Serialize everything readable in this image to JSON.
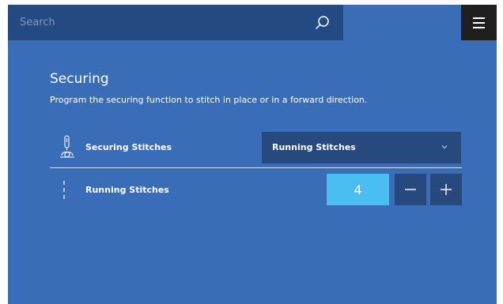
{
  "search": {
    "placeholder": "Search",
    "value": ""
  },
  "colors": {
    "background": "#3a6db8",
    "search_bar": "#244a84",
    "menu_button": "#1f1f1f",
    "field": "#26497e",
    "value_highlight": "#4bbef1"
  },
  "icons": {
    "search": "search-icon",
    "menu": "hamburger-menu-icon",
    "securing_stitches": "needle-knot-icon",
    "running_stitches": "dashed-line-icon",
    "dropdown": "chevron-down-icon",
    "decrease": "minus-icon",
    "increase": "plus-icon"
  },
  "section": {
    "title": "Securing",
    "description": "Program the securing function to stitch in place or in a forward direction."
  },
  "rows": {
    "securing": {
      "label": "Securing Stitches",
      "selected": "Running Stitches"
    },
    "running": {
      "label": "Running Stitches",
      "value": "4"
    }
  }
}
